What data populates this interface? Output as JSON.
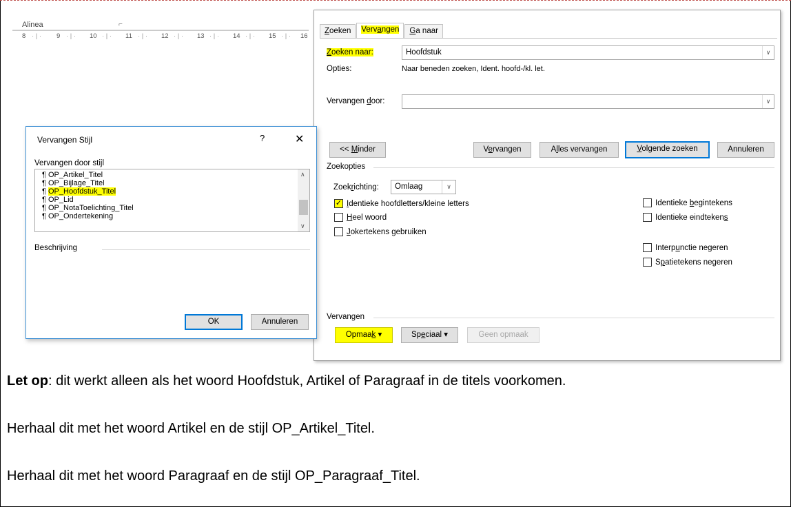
{
  "ruler": {
    "alinea_label": "Alinea",
    "launcher_icon": "dialog-launcher-icon",
    "ticks": [
      "8",
      "9",
      "10",
      "11",
      "12",
      "13",
      "14",
      "15",
      "16"
    ]
  },
  "find_replace": {
    "tabs": [
      {
        "label": "Zoeken",
        "underline": "Z",
        "rest": "oeken",
        "active": false
      },
      {
        "label": "Vervangen",
        "pre": "Verv",
        "underline": "a",
        "rest": "ngen",
        "active": true
      },
      {
        "label": "Ga naar",
        "underline": "G",
        "rest": "a naar",
        "active": false
      }
    ],
    "find_label_u": "Z",
    "find_label_rest": "oeken naar:",
    "find_value": "Hoofdstuk",
    "options_label": "Opties:",
    "options_value": "Naar beneden zoeken, Ident. hoofd-/kl. let.",
    "replace_label_pre": "Vervangen ",
    "replace_label_u": "d",
    "replace_label_rest": "oor:",
    "replace_value": "",
    "buttons": {
      "less_pre": "<< ",
      "less_u": "M",
      "less_rest": "inder",
      "replace_pre": "V",
      "replace_u": "e",
      "replace_rest": "rvangen",
      "replace_all_pre": "A",
      "replace_all_u": "l",
      "replace_all_rest": "les vervangen",
      "find_next_u": "V",
      "find_next_rest": "olgende zoeken",
      "cancel": "Annuleren"
    },
    "search_options_title": "Zoekopties",
    "direction_label_pre": "Zoek",
    "direction_label_u": "r",
    "direction_label_rest": "ichting:",
    "direction_value": "Omlaag",
    "checkboxes_left": [
      {
        "u": "I",
        "rest": "dentieke hoofdletters/kleine letters",
        "checked": true
      },
      {
        "u": "H",
        "rest": "eel woord",
        "checked": false
      },
      {
        "u": "J",
        "rest": "okertekens gebruiken",
        "checked": false
      }
    ],
    "checkboxes_right": [
      {
        "pre": "Identieke ",
        "u": "b",
        "rest": "egintekens",
        "checked": false
      },
      {
        "pre": "Identieke eindteken",
        "u": "s",
        "rest": "",
        "checked": false
      },
      {
        "pre": "Interp",
        "u": "u",
        "rest": "nctie negeren",
        "checked": false
      },
      {
        "pre": "S",
        "u": "p",
        "rest": "atietekens negeren",
        "checked": false
      }
    ],
    "replace_section_title": "Vervangen",
    "format_btn_pre": "Opmaa",
    "format_btn_u": "k",
    "format_btn_rest": " ▾",
    "special_btn_pre": "Sp",
    "special_btn_u": "e",
    "special_btn_rest": "ciaal ▾",
    "no_format_btn": "Geen opmaak"
  },
  "style_dialog": {
    "title": "Vervangen Stijl",
    "help": "?",
    "close": "✕",
    "list_label": "Vervangen door stijl",
    "styles": [
      {
        "label": "OP_Artikel_Titel",
        "selected": false
      },
      {
        "label": "OP_Bijlage_Titel",
        "selected": false
      },
      {
        "label": "OP_Hoofdstuk_Titel",
        "selected": true
      },
      {
        "label": "OP_Lid",
        "selected": false
      },
      {
        "label": "OP_NotaToelichting_Titel",
        "selected": false
      },
      {
        "label": "OP_Ondertekening",
        "selected": false
      }
    ],
    "pilcrow": "¶",
    "description_label": "Beschrijving",
    "ok": "OK",
    "cancel": "Annuleren"
  },
  "instructions": {
    "note_bold": "Let op",
    "note_rest": ": dit werkt alleen als het woord Hoofdstuk, Artikel of Paragraaf in de titels voorkomen.",
    "line2": "Herhaal dit met het woord Artikel en de stijl OP_Artikel_Titel.",
    "line3": "Herhaal dit met het woord Paragraaf en de stijl OP_Paragraaf_Titel."
  },
  "colors": {
    "highlight": "#ffff00",
    "focus_border": "#0078d7",
    "dialog_border": "#3c8fd4"
  }
}
